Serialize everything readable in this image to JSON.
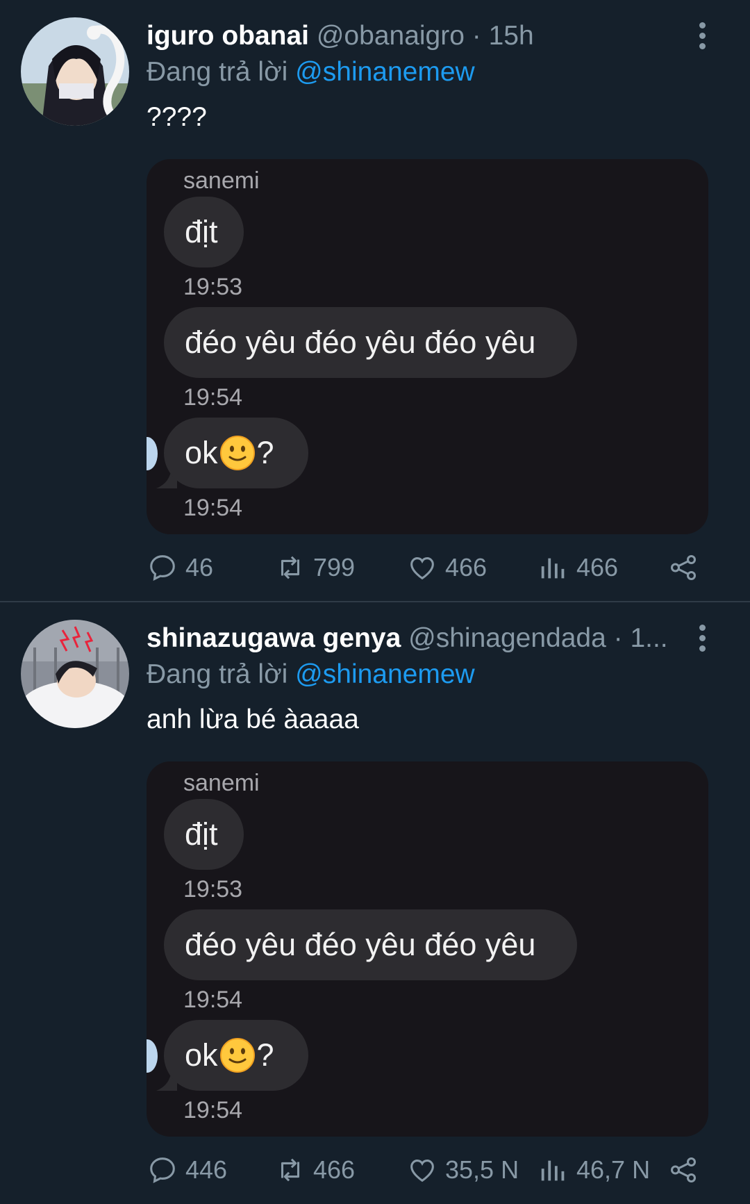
{
  "tweets": [
    {
      "name": "iguro obanai",
      "handle": "@obanaigro · 15h",
      "reply_prefix": "Đang trả lời ",
      "reply_to": "@shinanemew",
      "text": "????",
      "chat": {
        "sender": "sanemi",
        "messages": [
          {
            "text": "địt",
            "time": "19:53"
          },
          {
            "text": "đéo yêu đéo yêu đéo yêu",
            "time": "19:54"
          },
          {
            "text": "ok",
            "suffix": "?",
            "time": "19:54"
          }
        ]
      },
      "stats": {
        "replies": "46",
        "retweets": "799",
        "likes": "466",
        "views": "466"
      }
    },
    {
      "name": "shinazugawa genya",
      "handle": "@shinagendada · 1...",
      "reply_prefix": "Đang trả lời ",
      "reply_to": "@shinanemew",
      "text": "anh lừa bé àaaaa",
      "chat": {
        "sender": "sanemi",
        "messages": [
          {
            "text": "địt",
            "time": "19:53"
          },
          {
            "text": "đéo yêu đéo yêu đéo yêu",
            "time": "19:54"
          },
          {
            "text": "ok",
            "suffix": "?",
            "time": "19:54"
          }
        ]
      },
      "stats": {
        "replies": "446",
        "retweets": "466",
        "likes": "35,5 N",
        "views": "46,7 N"
      }
    }
  ],
  "colors": {
    "background": "#15202b",
    "accent": "#1d9bf0",
    "muted": "#8899a6",
    "chat_bg": "#17151a",
    "bubble": "#2d2c30"
  },
  "icons": [
    "reply-icon",
    "retweet-icon",
    "like-icon",
    "views-icon",
    "share-icon",
    "more-icon",
    "slightly-smiling-emoji"
  ]
}
